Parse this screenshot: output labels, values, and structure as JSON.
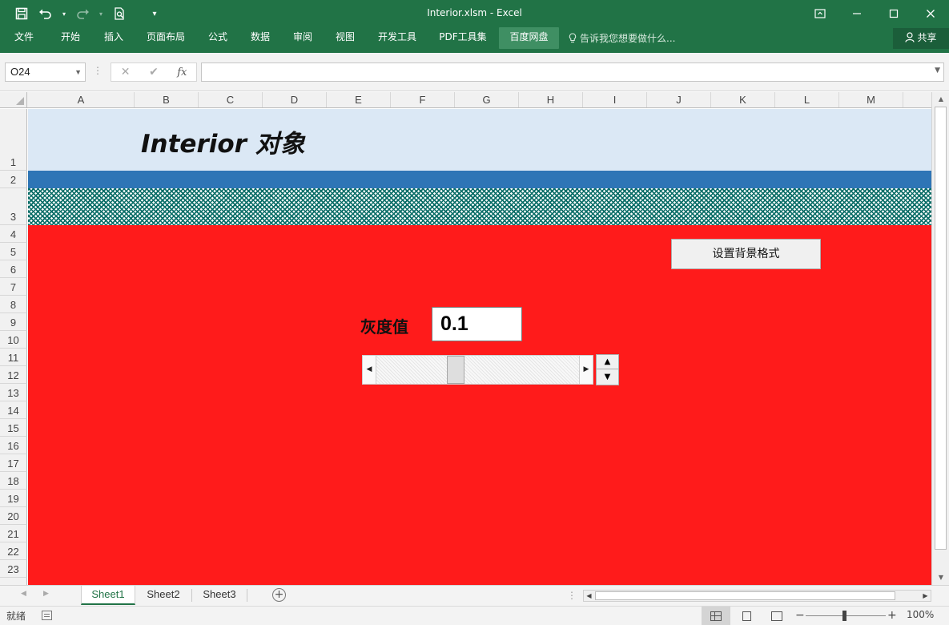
{
  "window": {
    "title": "Interior.xlsm - Excel"
  },
  "qat": {
    "save_icon": "save-icon",
    "undo_icon": "undo-icon",
    "redo_icon": "redo-icon",
    "print_preview_icon": "print-preview-icon",
    "customize_icon": "customize-icon"
  },
  "ribbon": {
    "tabs": [
      "文件",
      "开始",
      "插入",
      "页面布局",
      "公式",
      "数据",
      "审阅",
      "视图",
      "开发工具",
      "PDF工具集",
      "百度网盘"
    ],
    "active_tab": "百度网盘",
    "tell_me": "告诉我您想要做什么...",
    "share": "共享"
  },
  "formula_bar": {
    "name_box": "O24",
    "cancel_glyph": "✕",
    "enter_glyph": "✔",
    "fx_label": "fx",
    "formula": ""
  },
  "sheet": {
    "columns": [
      "A",
      "B",
      "C",
      "D",
      "E",
      "F",
      "G",
      "H",
      "I",
      "J",
      "K",
      "L",
      "M"
    ],
    "rows": [
      "1",
      "2",
      "3",
      "4",
      "5",
      "6",
      "7",
      "8",
      "9",
      "10",
      "11",
      "12",
      "13",
      "14",
      "15",
      "16",
      "17",
      "18",
      "19",
      "20",
      "21",
      "22",
      "23"
    ],
    "title": "Interior 对象",
    "set_background_button": "设置背景格式",
    "gray_label": "灰度值",
    "gray_value": "0.1",
    "scrollbar_value_fraction": 0.38,
    "colors": {
      "title_row": "#dbe8f5",
      "blue_row": "#2e75b6",
      "pattern_row": "#0a6e68",
      "red_area": "#ff1b1b",
      "excel_green": "#217346"
    }
  },
  "sheet_tabs": {
    "tabs": [
      "Sheet1",
      "Sheet2",
      "Sheet3"
    ],
    "active": "Sheet1"
  },
  "status_bar": {
    "status": "就绪",
    "zoom": "100%"
  }
}
